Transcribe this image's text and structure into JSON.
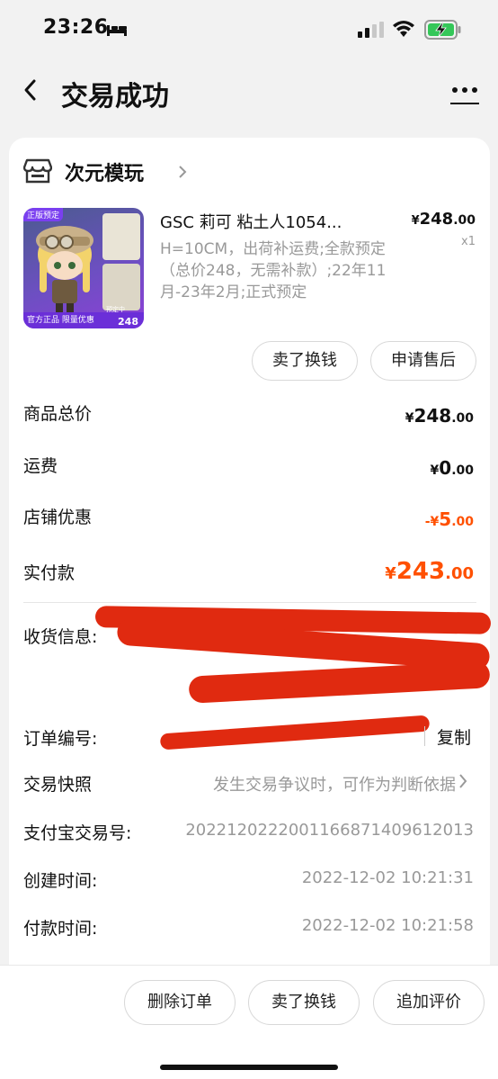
{
  "status_bar": {
    "time": "23:26"
  },
  "nav": {
    "title": "交易成功"
  },
  "shop": {
    "name": "次元模玩"
  },
  "product": {
    "title": "GSC 莉可 粘土人1054...",
    "price_yen": "¥",
    "price_int": "248",
    "price_dec": ".00",
    "qty": "x1",
    "spec": "H=10CM，出荷补运费;全款预定（总价248，无需补款）;22年11月-23年2月;正式预定",
    "image_tag_top": "正版预定",
    "image_tag_bottom": "官方正品  限量优惠",
    "image_price": "248",
    "image_side_label": "预定中",
    "buttons": {
      "sell": "卖了换钱",
      "after_sale": "申请售后"
    }
  },
  "summary": {
    "goods_total": {
      "label": "商品总价",
      "yen": "¥",
      "int": "248",
      "dec": ".00"
    },
    "shipping": {
      "label": "运费",
      "yen": "¥",
      "int": "0",
      "dec": ".00"
    },
    "shop_discount": {
      "label": "店铺优惠",
      "yen": "-¥",
      "int": "5",
      "dec": ".00"
    },
    "paid": {
      "label": "实付款",
      "yen": "¥",
      "int": "243",
      "dec": ".00"
    }
  },
  "info": {
    "shipping_info_label": "收货信息:",
    "order_no_label": "订单编号:",
    "copy_label": "复制",
    "snapshot_label": "交易快照",
    "snapshot_value": "发生交易争议时，可作为判断依据",
    "alipay_label": "支付宝交易号:",
    "alipay_value": "2022120222001166871409612013",
    "created_label": "创建时间:",
    "created_value": "2022-12-02 10:21:31",
    "paid_label": "付款时间:",
    "paid_value": "2022-12-02 10:21:58"
  },
  "bottom_bar": {
    "delete": "删除订单",
    "sell": "卖了换钱",
    "review": "追加评价"
  },
  "colors": {
    "accent": "#ff5000",
    "redaction": "#e02a10",
    "muted": "#999999"
  }
}
